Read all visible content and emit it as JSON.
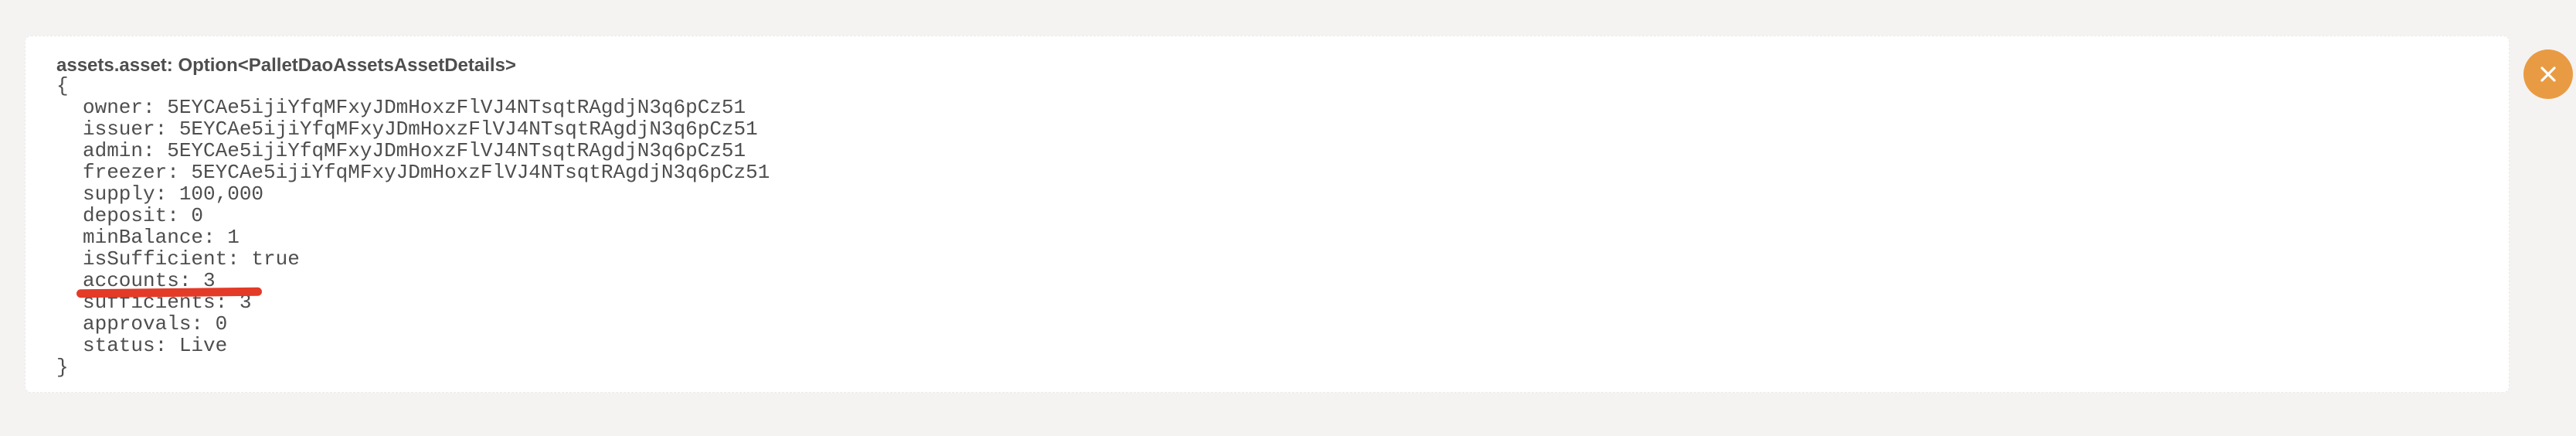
{
  "result": {
    "query_label": "assets.asset: Option<PalletDaoAssetsAssetDetails>",
    "open_brace": "{",
    "close_brace": "}",
    "fields": [
      "owner: 5EYCAe5ijiYfqMFxyJDmHoxzFlVJ4NTsqtRAgdjN3q6pCz51",
      "issuer: 5EYCAe5ijiYfqMFxyJDmHoxzFlVJ4NTsqtRAgdjN3q6pCz51",
      "admin: 5EYCAe5ijiYfqMFxyJDmHoxzFlVJ4NTsqtRAgdjN3q6pCz51",
      "freezer: 5EYCAe5ijiYfqMFxyJDmHoxzFlVJ4NTsqtRAgdjN3q6pCz51",
      "supply: 100,000",
      "deposit: 0",
      "minBalance: 1",
      "isSufficient: true",
      "accounts: 3",
      "sufficients: 3",
      "approvals: 0",
      "status: Live"
    ]
  },
  "annotation": {
    "highlighted_field": "accounts: 3",
    "color": "#e43a28"
  },
  "close_button": {
    "icon": "close-icon",
    "color": "#e99b43"
  }
}
